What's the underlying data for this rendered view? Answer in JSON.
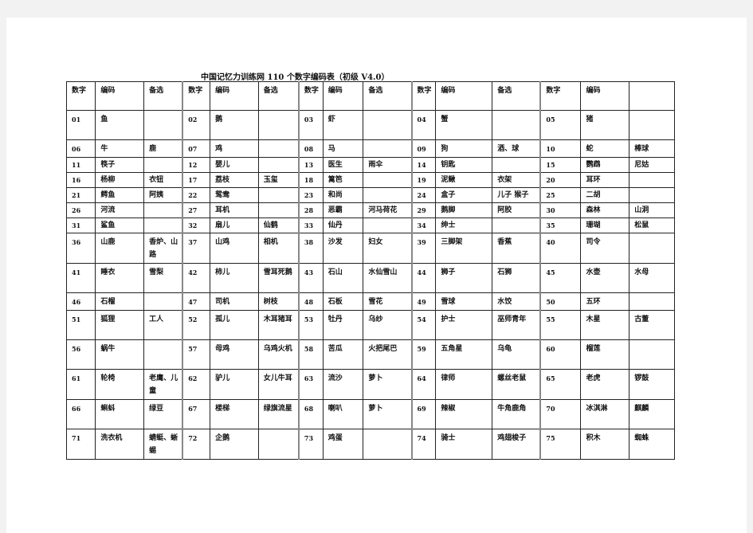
{
  "title": "中国记忆力训练网 110 个数字编码表（初级 V4.0）",
  "header": [
    "数字",
    "编码",
    "备选",
    "数字",
    "编码",
    "备选",
    "数字",
    "编码",
    "备选",
    "数字",
    "编码",
    "备选",
    "数字",
    "编码",
    ""
  ],
  "rows": [
    {
      "cells": [
        [
          "01",
          "鱼",
          ""
        ],
        [
          "02",
          "鹅",
          ""
        ],
        [
          "03",
          "虾",
          ""
        ],
        [
          "04",
          "蟹",
          ""
        ],
        [
          "05",
          "猪",
          ""
        ]
      ]
    },
    {
      "cells": [
        [
          "06",
          "牛",
          "鹿"
        ],
        [
          "07",
          "鸡",
          ""
        ],
        [
          "08",
          "马",
          ""
        ],
        [
          "09",
          "狗",
          "酒、球"
        ],
        [
          "10",
          "蛇",
          "棒球"
        ]
      ]
    },
    {
      "cells": [
        [
          "11",
          "筷子",
          ""
        ],
        [
          "12",
          "婴儿",
          ""
        ],
        [
          "13",
          "医生",
          "雨伞"
        ],
        [
          "14",
          "钥匙",
          ""
        ],
        [
          "15",
          "鹦鹉",
          "尼姑"
        ]
      ]
    },
    {
      "cells": [
        [
          "16",
          "杨柳",
          "衣钮"
        ],
        [
          "17",
          "荔枝",
          "玉玺"
        ],
        [
          "18",
          "篱笆",
          ""
        ],
        [
          "19",
          "泥鳅",
          "衣架"
        ],
        [
          "20",
          "耳环",
          ""
        ]
      ]
    },
    {
      "cells": [
        [
          "21",
          "鳄鱼",
          "阿姨"
        ],
        [
          "22",
          "鸳鸯",
          ""
        ],
        [
          "23",
          "和尚",
          ""
        ],
        [
          "24",
          "盒子",
          "儿子 猴子"
        ],
        [
          "25",
          "二胡",
          ""
        ]
      ]
    },
    {
      "cells": [
        [
          "26",
          "河流",
          ""
        ],
        [
          "27",
          "耳机",
          ""
        ],
        [
          "28",
          "恶霸",
          "河马荷花"
        ],
        [
          "29",
          "鹅脚",
          "阿胶"
        ],
        [
          "30",
          "森林",
          "山洞"
        ]
      ]
    },
    {
      "cells": [
        [
          "31",
          "鲨鱼",
          ""
        ],
        [
          "32",
          "扇儿",
          "仙鹤"
        ],
        [
          "33",
          "仙丹",
          ""
        ],
        [
          "34",
          "绅士",
          ""
        ],
        [
          "35",
          "珊瑚",
          "松鼠"
        ]
      ]
    },
    {
      "cells": [
        [
          "36",
          "山鹿",
          "香炉、山路"
        ],
        [
          "37",
          "山鸡",
          "相机"
        ],
        [
          "38",
          "沙发",
          "妇女"
        ],
        [
          "39",
          "三脚架",
          "香蕉"
        ],
        [
          "40",
          "司令",
          ""
        ]
      ]
    },
    {
      "cells": [
        [
          "41",
          "睡衣",
          "雪梨"
        ],
        [
          "42",
          "柿儿",
          "雪耳死鹅"
        ],
        [
          "43",
          "石山",
          "水仙雪山"
        ],
        [
          "44",
          "狮子",
          "石狮"
        ],
        [
          "45",
          "水壶",
          "水母"
        ]
      ]
    },
    {
      "cells": [
        [
          "46",
          "石榴",
          ""
        ],
        [
          "47",
          "司机",
          "树枝"
        ],
        [
          "48",
          "石板",
          "雪花"
        ],
        [
          "49",
          "雪球",
          "水饺"
        ],
        [
          "50",
          "五环",
          ""
        ]
      ]
    },
    {
      "cells": [
        [
          "51",
          "狐狸",
          "工人"
        ],
        [
          "52",
          "孤儿",
          "木耳猪耳"
        ],
        [
          "53",
          "牡丹",
          "乌纱"
        ],
        [
          "54",
          "护士",
          "巫师青年"
        ],
        [
          "55",
          "木星",
          "古董"
        ]
      ]
    },
    {
      "cells": [
        [
          "56",
          "蜗牛",
          ""
        ],
        [
          "57",
          "母鸡",
          "乌鸡火机"
        ],
        [
          "58",
          "苦瓜",
          "火把尾巴"
        ],
        [
          "59",
          "五角星",
          "乌龟"
        ],
        [
          "60",
          "榴莲",
          ""
        ]
      ]
    },
    {
      "cells": [
        [
          "61",
          "轮椅",
          "老鹰、儿童"
        ],
        [
          "62",
          "驴儿",
          "女儿牛耳"
        ],
        [
          "63",
          "流沙",
          "萝卜"
        ],
        [
          "64",
          "律师",
          "螺丝老鼠"
        ],
        [
          "65",
          "老虎",
          "锣鼓"
        ]
      ]
    },
    {
      "cells": [
        [
          "66",
          "蝌蚪",
          "绿豆"
        ],
        [
          "67",
          "楼梯",
          "绿旗流星"
        ],
        [
          "68",
          "喇叭",
          "萝卜"
        ],
        [
          "69",
          "辣椒",
          "牛角鹿角"
        ],
        [
          "70",
          "冰淇淋",
          "麒麟"
        ]
      ]
    },
    {
      "cells": [
        [
          "71",
          "洗衣机",
          "蜻蜓、蜥蜴"
        ],
        [
          "72",
          "企鹅",
          ""
        ],
        [
          "73",
          "鸡蛋",
          ""
        ],
        [
          "74",
          "骑士",
          "鸡翅梭子"
        ],
        [
          "75",
          "积木",
          "蜘蛛"
        ]
      ]
    }
  ]
}
